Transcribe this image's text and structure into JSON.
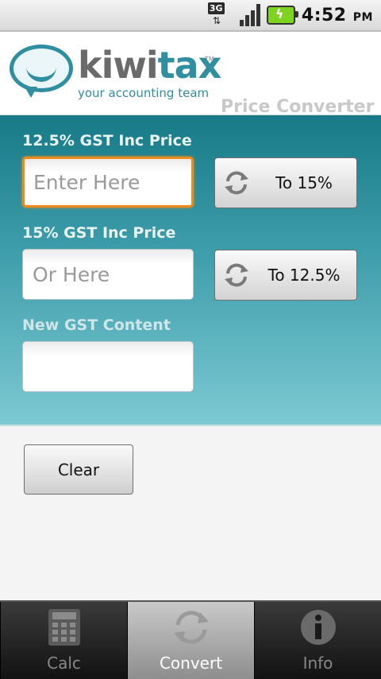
{
  "status_bar": {
    "network": "3G",
    "time": "4:52",
    "ampm": "PM",
    "icons": [
      "3g-data-icon",
      "signal-bars-icon",
      "battery-charging-icon"
    ]
  },
  "header": {
    "logo_word_left": "kiwi",
    "logo_word_right": "tax",
    "logo_tm": "TM",
    "logo_tagline": "your accounting team",
    "title": "Price Converter"
  },
  "form": {
    "field1_label": "12.5% GST Inc Price",
    "field1_placeholder": "Enter Here",
    "field2_label": "15% GST Inc Price",
    "field2_placeholder": "Or Here",
    "field3_label": "New GST Content",
    "field3_value": "",
    "btn1_label": "To 15%",
    "btn2_label": "To 12.5%"
  },
  "actions": {
    "clear_label": "Clear"
  },
  "tabs": [
    {
      "label": "Calc",
      "icon": "calculator-icon",
      "active": false
    },
    {
      "label": "Convert",
      "icon": "refresh-icon",
      "active": true
    },
    {
      "label": "Info",
      "icon": "info-icon",
      "active": false
    }
  ],
  "colors": {
    "accent": "#2f8ea0",
    "focus": "#ef8b1c",
    "panel_top": "#177a86",
    "panel_bottom": "#7cc9d3"
  }
}
